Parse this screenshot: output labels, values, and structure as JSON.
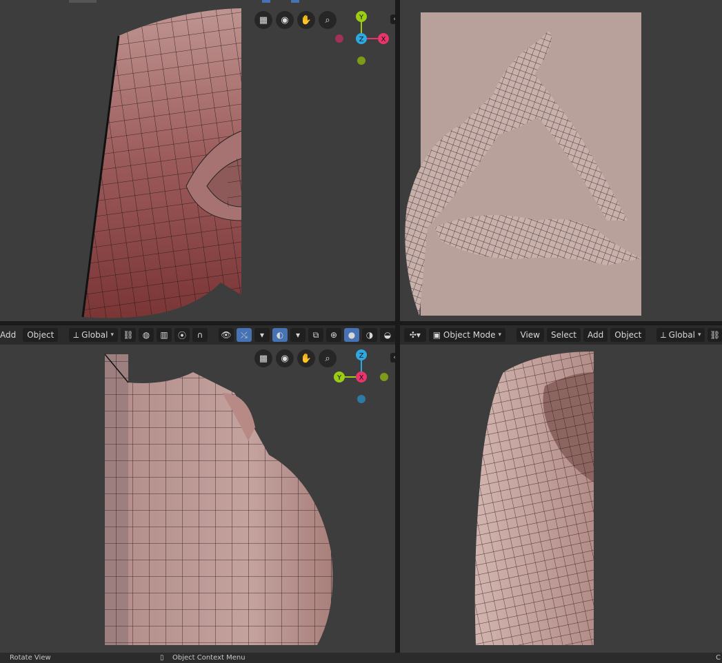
{
  "header_left": {
    "add_label": "Add",
    "object_label": "Object",
    "orientation_label": "Global"
  },
  "header_right": {
    "mode_label": "Object Mode",
    "view_label": "View",
    "select_label": "Select",
    "add_label": "Add",
    "object_label": "Object",
    "orientation_label": "Global"
  },
  "gizmo_top_left": {
    "top": "Y",
    "center": "Z",
    "right": "X"
  },
  "gizmo_bottom_left": {
    "top": "Z",
    "left": "Y",
    "center": "X"
  },
  "statusbar": {
    "left": "Rotate View",
    "middle": "Object Context Menu",
    "right": "C"
  },
  "icons": [
    "grid-icon",
    "camera-icon",
    "hand-icon",
    "zoom-icon",
    "transform-icon",
    "link-icon",
    "snap-icon",
    "proportional-icon",
    "visibility-icon",
    "gizmo-icon",
    "overlay-icon",
    "xray-icon",
    "wireframe-icon",
    "solid-icon",
    "material-icon",
    "rendered-icon",
    "cursor-icon",
    "object-mode-icon"
  ],
  "colors": {
    "accent": "#4772b3",
    "axis_x": "#e8356c",
    "axis_y": "#9dcc16",
    "axis_z": "#2ea8e0",
    "mesh_fill": "#c8a49f",
    "mesh_dark": "#7a3c3c"
  }
}
